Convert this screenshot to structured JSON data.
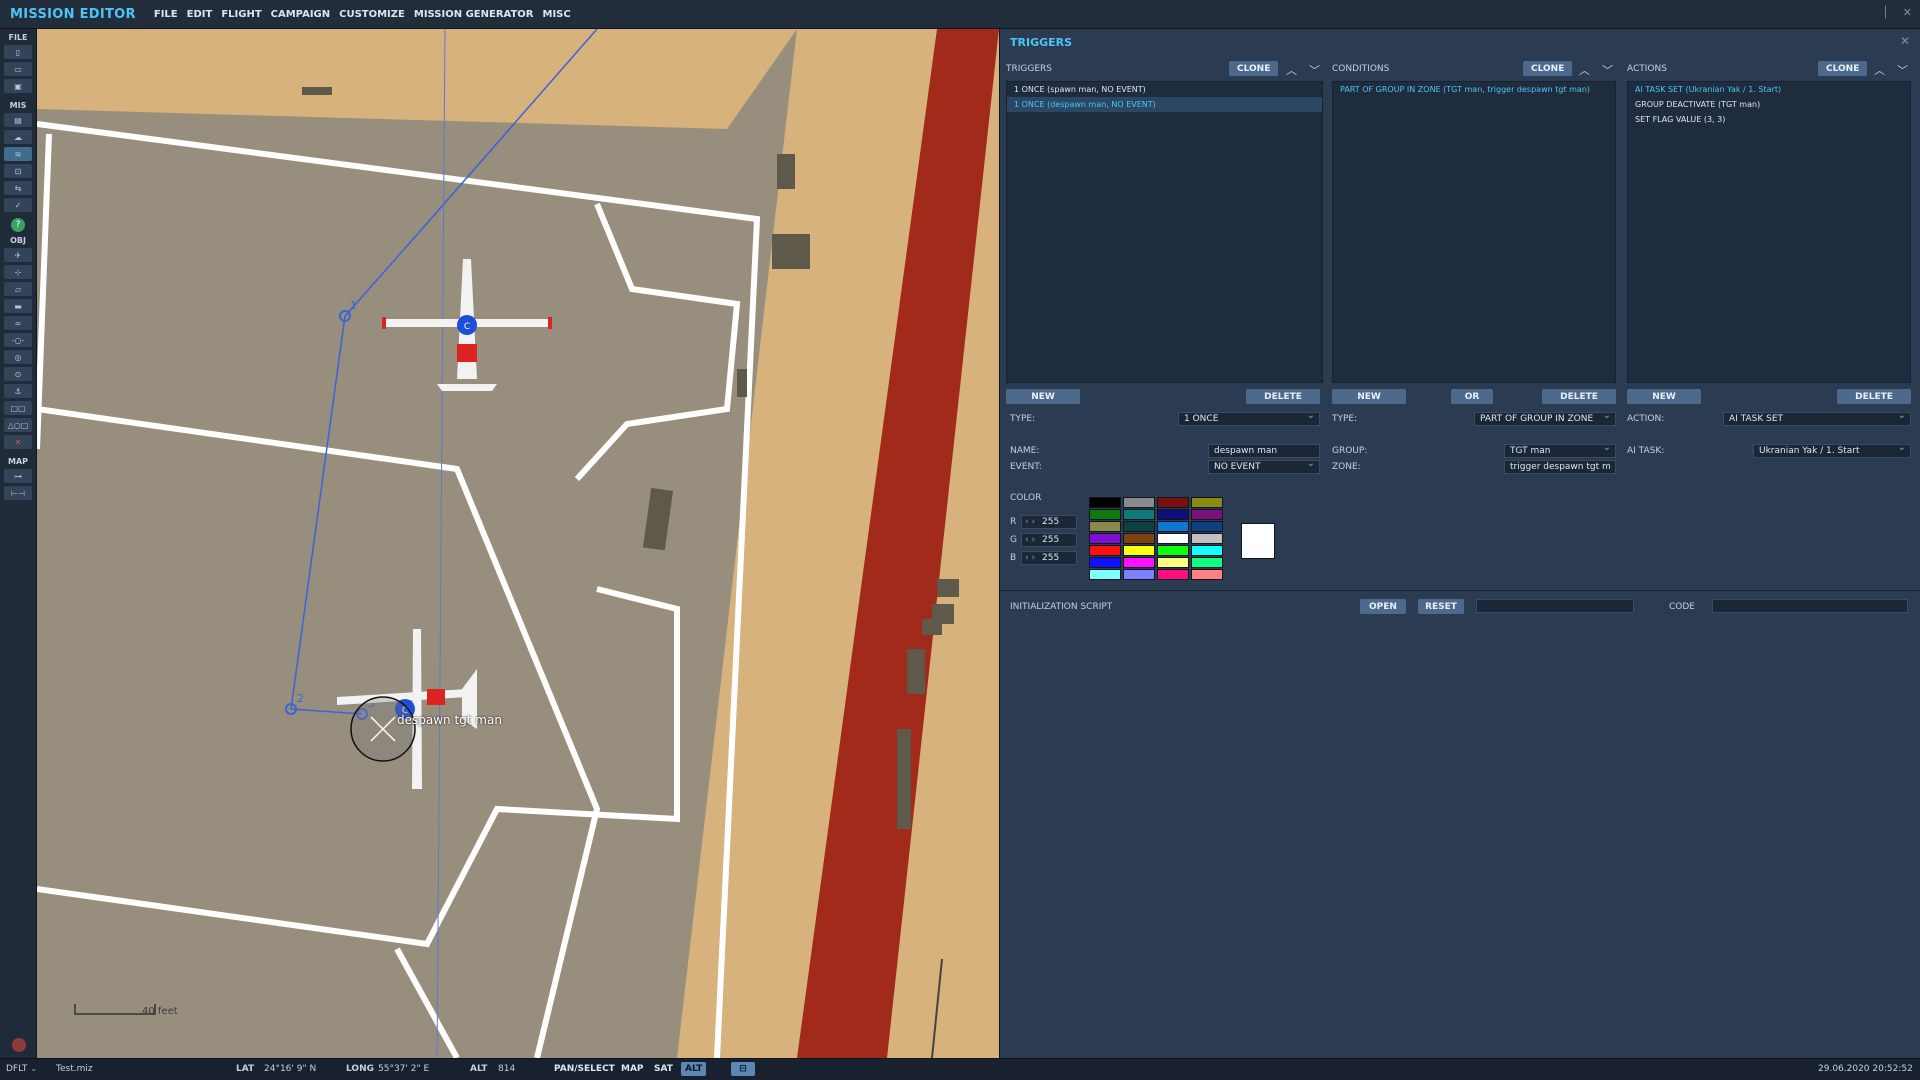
{
  "app": {
    "title": "MISSION EDITOR"
  },
  "menu": [
    "FILE",
    "EDIT",
    "FLIGHT",
    "CAMPAIGN",
    "CUSTOMIZE",
    "MISSION GENERATOR",
    "MISC"
  ],
  "toolbar": {
    "sections": {
      "file": "FILE",
      "mis": "MIS",
      "obj": "OBJ",
      "map": "MAP"
    }
  },
  "map": {
    "zone_label": "despawn tgt man",
    "waypoints": [
      "1",
      "2",
      "3"
    ],
    "unit_marker": "C",
    "scale": "40 feet",
    "colors": {
      "sand": "#d8b27c",
      "apron": "#978e7e",
      "runway": "#a12a1a",
      "markings": "#ffffff",
      "route": "#3b63d8"
    }
  },
  "panel": {
    "title": "TRIGGERS",
    "triggers": {
      "label": "TRIGGERS",
      "clone": "CLONE",
      "items": [
        "1 ONCE (spawn man, NO EVENT)",
        "1 ONCE (despawn man, NO EVENT)"
      ],
      "selected_index": 1,
      "new": "NEW",
      "delete": "DELETE",
      "type_label": "TYPE:",
      "type_value": "1 ONCE",
      "name_label": "NAME:",
      "name_value": "despawn man",
      "event_label": "EVENT:",
      "event_value": "NO EVENT"
    },
    "conditions": {
      "label": "CONDITIONS",
      "clone": "CLONE",
      "items": [
        "PART OF GROUP IN ZONE (TGT man, trigger despawn tgt man)"
      ],
      "new": "NEW",
      "or": "OR",
      "delete": "DELETE",
      "type_label": "TYPE:",
      "type_value": "PART OF GROUP IN ZONE",
      "group_label": "GROUP:",
      "group_value": "TGT man",
      "zone_label": "ZONE:",
      "zone_value": "trigger despawn tgt m"
    },
    "actions": {
      "label": "ACTIONS",
      "clone": "CLONE",
      "items": [
        "AI TASK SET (Ukranian Yak / 1. Start)",
        "GROUP DEACTIVATE (TGT man)",
        "SET FLAG VALUE (3, 3)"
      ],
      "new": "NEW",
      "delete": "DELETE",
      "action_label": "ACTION:",
      "action_value": "AI TASK SET",
      "aitask_label": "AI TASK:",
      "aitask_value": "Ukranian Yak / 1. Start"
    },
    "color": {
      "label": "COLOR",
      "r_label": "R",
      "r_value": "255",
      "g_label": "G",
      "g_value": "255",
      "b_label": "B",
      "b_value": "255",
      "preview": "#ffffff",
      "palette": [
        "#000000",
        "#8a8a8a",
        "#7a0f0f",
        "#8a8a10",
        "#0f7a0f",
        "#0f7a7a",
        "#10107a",
        "#7a107a",
        "#8a8a4a",
        "#104040",
        "#1078d0",
        "#104080",
        "#8010d0",
        "#804010",
        "#ffffff",
        "#c0c0c0",
        "#ff1010",
        "#ffff10",
        "#10ff10",
        "#10ffff",
        "#1010ff",
        "#ff10ff",
        "#ffff80",
        "#10ff80",
        "#80ffff",
        "#8080ff",
        "#ff1080",
        "#ff8080"
      ]
    },
    "init_script": {
      "label": "INITIALIZATION SCRIPT",
      "open": "OPEN",
      "reset": "RESET",
      "code_label": "CODE"
    }
  },
  "status": {
    "profile": "DFLT",
    "file": "Test.miz",
    "lat_label": "LAT",
    "lat_value": "24°16' 9\" N",
    "long_label": "LONG",
    "long_value": "55°37' 2\" E",
    "alt_label": "ALT",
    "alt_value": "814",
    "pan_select": "PAN/SELECT",
    "map_btn": "MAP",
    "sat_btn": "SAT",
    "alt_btn": "ALT",
    "datetime": "29.06.2020 20:52:52"
  }
}
